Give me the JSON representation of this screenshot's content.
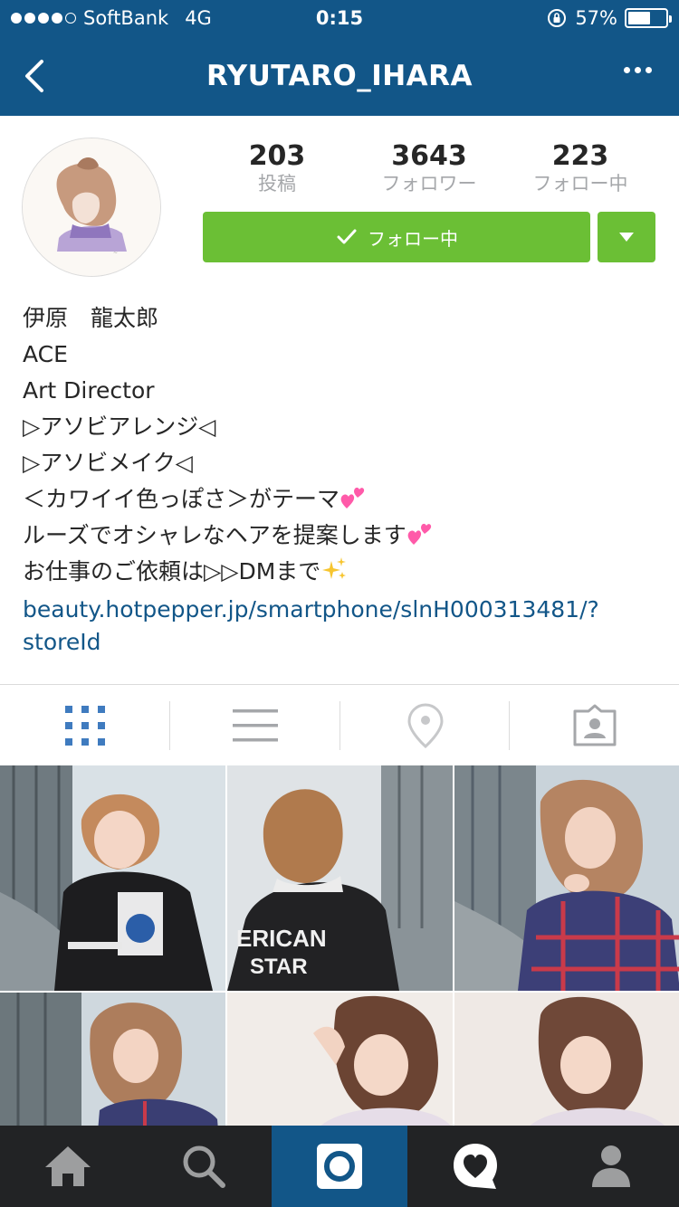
{
  "status_bar": {
    "carrier": "SoftBank",
    "network": "4G",
    "time": "0:15",
    "battery_text": "57%",
    "battery_level": 0.57,
    "signal_bars": 4,
    "signal_max": 5
  },
  "nav": {
    "title": "RYUTARO_IHARA"
  },
  "profile": {
    "stats": [
      {
        "value": "203",
        "label": "投稿"
      },
      {
        "value": "3643",
        "label": "フォロワー"
      },
      {
        "value": "223",
        "label": "フォロー中"
      }
    ],
    "follow_button_label": "フォロー中",
    "bio_lines": [
      "伊原　龍太郎",
      "ACE",
      "Art Director",
      "▷アソビアレンジ◁",
      "▷アソビメイク◁",
      "＜カワイイ色っぽさ＞がテーマ",
      "ルーズでオシャレなヘアを提案します",
      "お仕事のご依頼は▷▷DMまで"
    ],
    "link_line1": "beauty.hotpepper.jp/smartphone/slnH000313481/?",
    "link_line2": "storeId"
  },
  "tabs": [
    {
      "icon": "grid-icon",
      "active": true
    },
    {
      "icon": "list-icon",
      "active": false
    },
    {
      "icon": "location-pin-icon",
      "active": false
    },
    {
      "icon": "tagged-photos-icon",
      "active": false
    }
  ],
  "bottom_nav": [
    {
      "icon": "home-icon",
      "active": false
    },
    {
      "icon": "search-icon",
      "active": false
    },
    {
      "icon": "camera-icon",
      "active": true
    },
    {
      "icon": "activity-heart-icon",
      "active": false
    },
    {
      "icon": "profile-icon",
      "active": false
    }
  ],
  "colors": {
    "header": "#125688",
    "follow_green": "#6bbf35",
    "link": "#125688",
    "tab_active": "#3f7bbf",
    "tab_inactive": "#a5a7aa",
    "bottom_bar": "#222325"
  }
}
